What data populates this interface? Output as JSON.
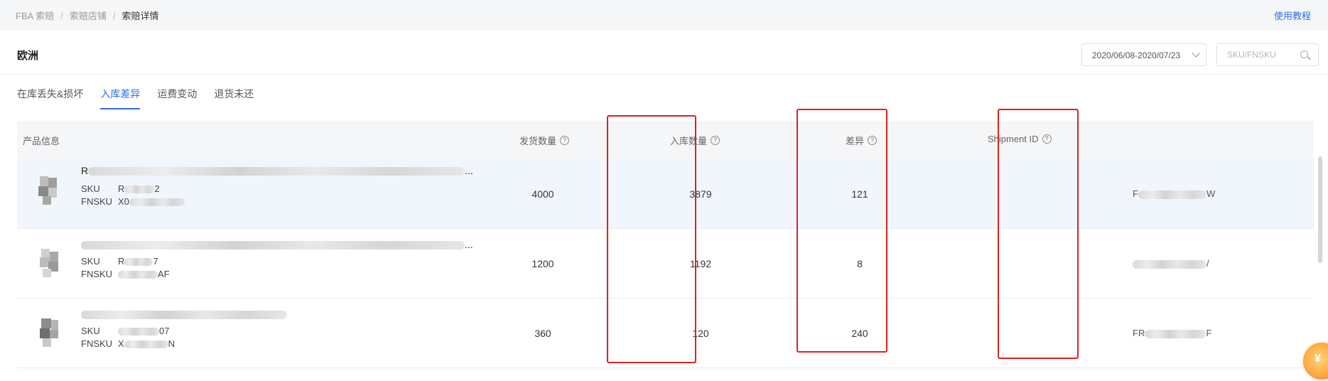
{
  "breadcrumb": [
    "FBA 索赔",
    "索赔店铺",
    "索赔详情"
  ],
  "help_link": "使用教程",
  "page_title": "欧洲",
  "date_range": "2020/06/08-2020/07/23",
  "search_placeholder": "SKU/FNSKU",
  "tabs": [
    {
      "label": "在库丢失&损坏",
      "active": false
    },
    {
      "label": "入库差异",
      "active": true
    },
    {
      "label": "运费变动",
      "active": false
    },
    {
      "label": "退货未还",
      "active": false
    }
  ],
  "columns": {
    "product": "产品信息",
    "shipped": "发货数量",
    "received": "入库数量",
    "diff": "差异",
    "shipment_id": "Shipment ID"
  },
  "labels": {
    "sku": "SKU",
    "fnsku": "FNSKU"
  },
  "rows": [
    {
      "name_prefix": "R",
      "name_suffix": "...",
      "sku_prefix": "R",
      "sku_suffix": "2",
      "fnsku_prefix": "X0",
      "fnsku_suffix": "",
      "shipped": "4000",
      "received": "3879",
      "diff": "121",
      "shipment_prefix": "F",
      "shipment_suffix": "W"
    },
    {
      "name_prefix": "",
      "name_suffix": "...",
      "sku_prefix": "R",
      "sku_suffix": "7",
      "fnsku_prefix": "",
      "fnsku_suffix": "AF",
      "shipped": "1200",
      "received": "1192",
      "diff": "8",
      "shipment_prefix": "",
      "shipment_suffix": "/"
    },
    {
      "name_prefix": "",
      "name_suffix": "",
      "sku_prefix": "",
      "sku_suffix": "07",
      "fnsku_prefix": "X",
      "fnsku_suffix": "N",
      "shipped": "360",
      "received": "120",
      "diff": "240",
      "shipment_prefix": "FR",
      "shipment_suffix": "F"
    }
  ],
  "float_button_icon": "¥",
  "colors": {
    "accent": "#2f6fe4",
    "highlight_box": "#e02020",
    "row_hover": "#f1f6fd"
  }
}
